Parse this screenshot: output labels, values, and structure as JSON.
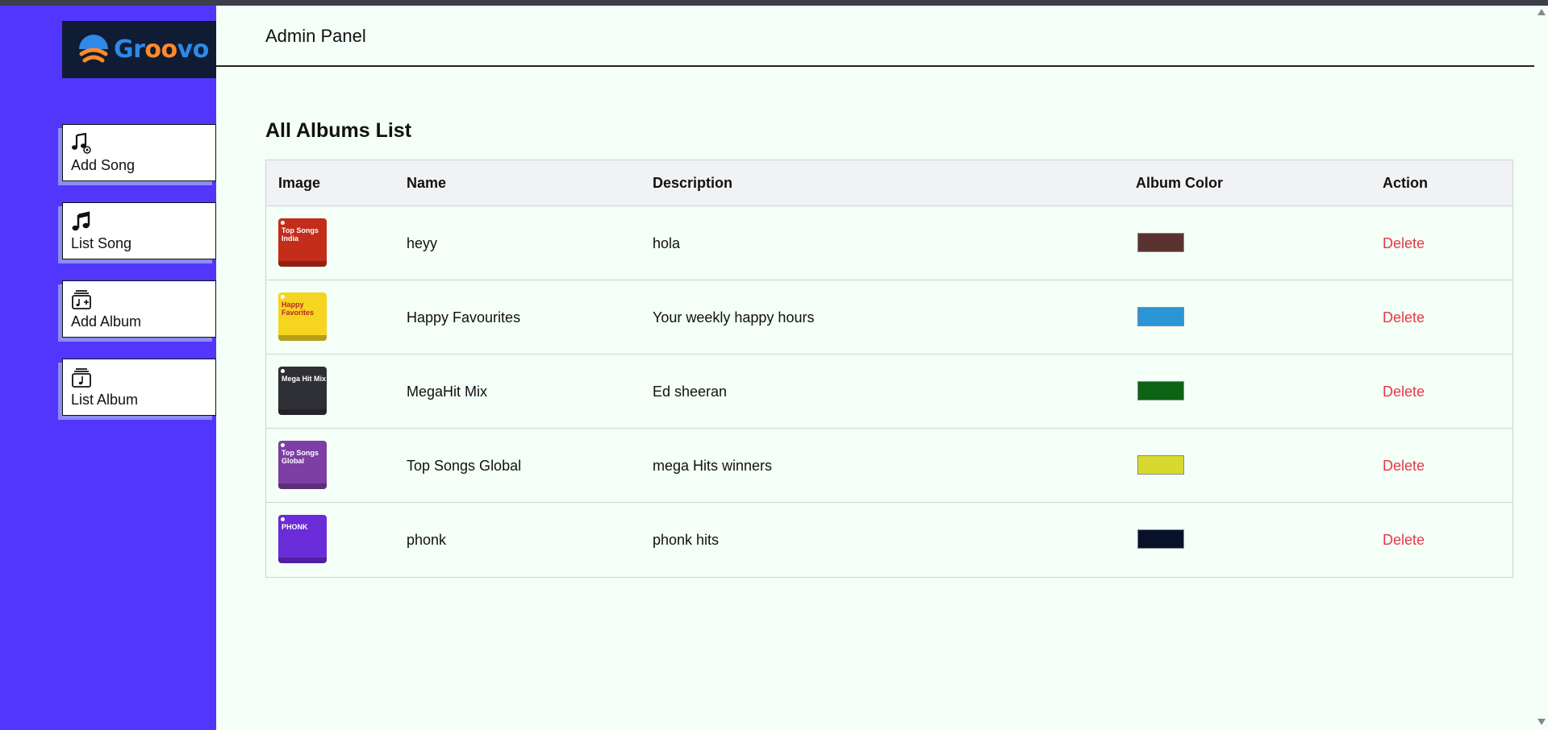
{
  "app": {
    "logo_text_start": "Gr",
    "logo_text_oo": "oo",
    "logo_text_end": "vo"
  },
  "sidebar": {
    "items": [
      {
        "label": "Add Song",
        "icon": "add-music-icon"
      },
      {
        "label": "List Song",
        "icon": "music-note-icon"
      },
      {
        "label": "Add Album",
        "icon": "add-album-icon"
      },
      {
        "label": "List Album",
        "icon": "album-list-icon"
      }
    ]
  },
  "header": {
    "title": "Admin Panel"
  },
  "main": {
    "title": "All Albums List",
    "columns": [
      "Image",
      "Name",
      "Description",
      "Album Color",
      "Action"
    ],
    "rows": [
      {
        "name": "heyy",
        "description": "hola",
        "color": "#5a3330",
        "action": "Delete",
        "thumb_bg": "#c32d1a",
        "thumb_label": "Top Songs India"
      },
      {
        "name": "Happy Favourites",
        "description": "Your weekly happy hours",
        "color": "#2c95d6",
        "action": "Delete",
        "thumb_bg": "#f5d51f",
        "thumb_label": "Happy Favorites"
      },
      {
        "name": "MegaHit Mix",
        "description": "Ed sheeran",
        "color": "#0e6213",
        "action": "Delete",
        "thumb_bg": "#2f2f36",
        "thumb_label": "Mega Hit Mix"
      },
      {
        "name": "Top Songs Global",
        "description": "mega Hits winners",
        "color": "#d8d92e",
        "action": "Delete",
        "thumb_bg": "#7d3fa3",
        "thumb_label": "Top Songs Global"
      },
      {
        "name": "phonk",
        "description": "phonk hits",
        "color": "#07122a",
        "action": "Delete",
        "thumb_bg": "#6a2bd8",
        "thumb_label": "PHONK"
      }
    ]
  },
  "colors": {
    "sidebar": "#5236fb",
    "background": "#f3fff7",
    "delete": "#e63946"
  }
}
